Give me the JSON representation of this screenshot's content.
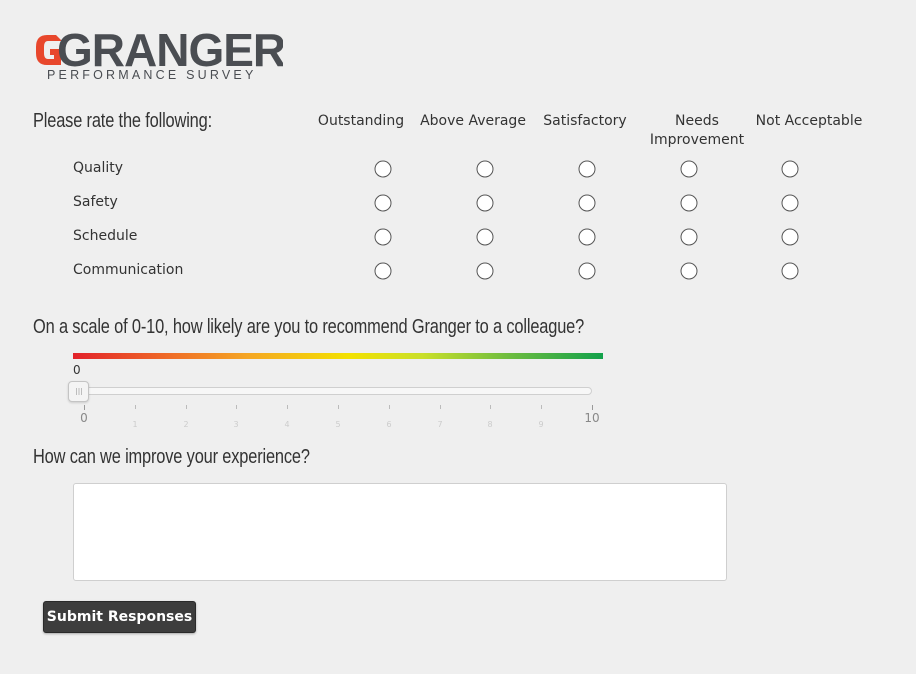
{
  "brand": {
    "name": "GRANGER",
    "subtitle": "PERFORMANCE SURVEY",
    "text_color": "#4a4d52",
    "accent_color": "#e8472c"
  },
  "rating": {
    "heading": "Please rate the following:",
    "columns": [
      "Outstanding",
      "Above Average",
      "Satisfactory",
      "Needs Improvement",
      "Not Acceptable"
    ],
    "rows": [
      "Quality",
      "Safety",
      "Schedule",
      "Communication"
    ]
  },
  "recommend": {
    "heading": "On a scale of 0-10, how likely are you to recommend Granger to a colleague?",
    "value": "0",
    "min": 0,
    "max": 10,
    "tick_labels": [
      "0",
      "1",
      "2",
      "3",
      "4",
      "5",
      "6",
      "7",
      "8",
      "9",
      "10"
    ],
    "gradient_colors": [
      "#e2222a",
      "#ef6b27",
      "#f5a623",
      "#f3e100",
      "#c9df2a",
      "#6fbd3f",
      "#12a14b"
    ]
  },
  "improve": {
    "heading": "How can we improve your experience?",
    "value": ""
  },
  "submit": {
    "label": "Submit Responses"
  }
}
